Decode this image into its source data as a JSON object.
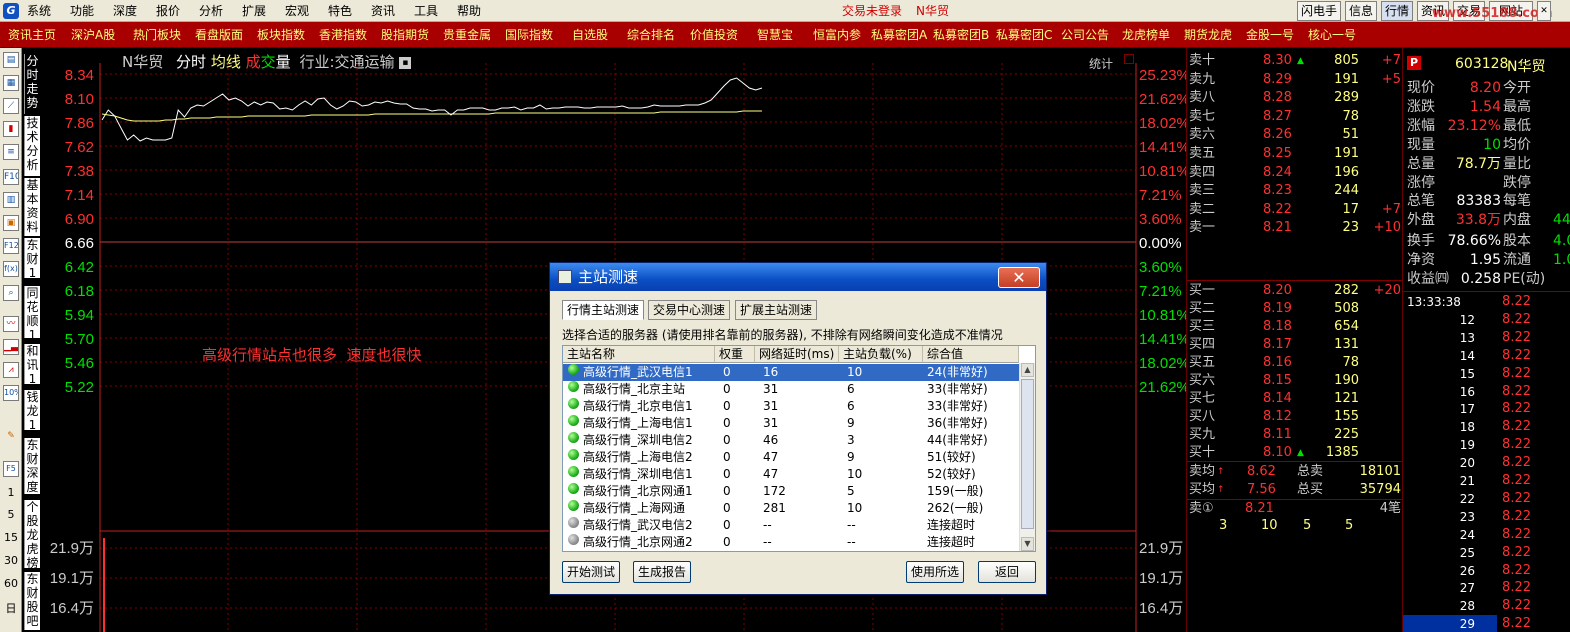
{
  "menubar": {
    "items": [
      "系统",
      "功能",
      "深度",
      "报价",
      "分析",
      "扩展",
      "宏观",
      "特色",
      "资讯",
      "工具",
      "帮助"
    ],
    "status_login": "交易未登录",
    "status_stock": "N华贸",
    "right_buttons": [
      "闪电手",
      "信息",
      "行情",
      "资讯",
      "交易",
      "网站"
    ],
    "watermark": "www.55188.com"
  },
  "tabbar": {
    "tabs": [
      "资讯主页",
      "深沪A股",
      "热门板块",
      "看盘版面",
      "板块指数",
      "香港指数",
      "股指期货",
      "贵重金属",
      "国际指数",
      "自选股",
      "综合排名",
      "价值投资",
      "智慧宝",
      "恒富内参",
      "私募密团A",
      "私募密团B",
      "私募密团C",
      "公司公告",
      "龙虎榜单",
      "期货龙虎",
      "金股一号",
      "核心一号"
    ]
  },
  "left_toolbar": {
    "icons": [
      "book-icon",
      "grid-icon",
      "line-chart-icon",
      "candle-chart-icon",
      "list-icon",
      "f10-icon",
      "table-icon",
      "calculator-icon",
      "f12-icon",
      "fx-icon",
      "magnifier-icon",
      "trend-icon",
      "bar-chart-icon",
      "mountain-chart-icon",
      "percent-icon",
      "pencil-icon",
      "f5-icon"
    ],
    "icon_text": {
      "f10": "F10",
      "f12": "F12",
      "fx": "f(x)",
      "pct": "10%",
      "f5": "F5"
    },
    "numbers": [
      "1",
      "5",
      "15",
      "30",
      "60",
      "日"
    ]
  },
  "vertical_tabs": [
    "分时走势",
    "技术分析",
    "基本资料",
    "东财10",
    "同花顺10",
    "和讯10",
    "钱龙10",
    "东财深度",
    "个股龙虎榜",
    "东财股吧"
  ],
  "chart": {
    "stock_name": "N华贸",
    "mode_labels": [
      "分时",
      "均线",
      "成",
      "交",
      "量"
    ],
    "industry_label": "行业:交通运输",
    "stats_button": "统计",
    "annotation": "高级行情站点也很多  速度也很快",
    "price_ticks": [
      "8.34",
      "8.10",
      "7.86",
      "7.62",
      "7.38",
      "7.14",
      "6.90",
      "6.66",
      "6.42",
      "6.18",
      "5.94",
      "5.70",
      "5.46",
      "5.22"
    ],
    "pct_ticks": [
      "25.23%",
      "21.62%",
      "18.02%",
      "14.41%",
      "10.81%",
      "7.21%",
      "3.60%",
      "0.00%",
      "3.60%",
      "7.21%",
      "10.81%",
      "14.41%",
      "18.02%",
      "21.62%"
    ],
    "volume_ticks": [
      "21.9万",
      "19.1万",
      "16.4万"
    ],
    "colors": {
      "up": "#ff3030",
      "down": "#00e000",
      "flat": "#ffffff",
      "grid": "#800000",
      "price_line": "#ffffff",
      "avg_line": "#ffff80"
    }
  },
  "chart_data": {
    "type": "line",
    "title": "N华贸",
    "xlabel": "",
    "ylabel": "",
    "ylim": [
      5.1,
      8.34
    ],
    "series": [
      {
        "values": [
          7.88,
          7.98,
          7.92,
          7.8,
          7.68,
          7.73,
          7.67,
          7.7,
          7.68,
          7.68,
          7.68,
          7.7,
          7.98,
          7.91,
          8.0,
          8.03,
          8.02,
          8.06,
          8.1,
          8.14,
          8.08,
          8.1,
          8.07,
          8.02,
          8.06,
          8.03,
          8.06,
          8.05,
          7.99,
          8.0,
          7.98,
          8.03,
          8.07,
          8.03,
          8.09,
          8.1,
          8.03,
          7.99,
          8.02,
          8.07,
          8.06,
          8.02,
          8.03,
          8.06,
          8.05,
          8.07,
          8.05,
          8.04,
          8.04,
          8.0,
          7.99,
          7.99,
          7.97,
          7.98,
          7.98,
          7.93,
          7.98,
          7.98,
          8.0,
          8.0,
          8.0,
          7.98,
          7.98,
          8.0,
          8.0,
          8.01,
          7.98,
          8.0,
          8.0,
          8.03,
          7.99,
          8.0,
          8.0,
          8.01,
          8.01,
          8.01,
          8.0,
          8.0,
          8.01,
          8.01,
          8.01,
          8.01,
          8.02,
          8.0,
          8.0,
          8.0,
          8.01,
          8.03,
          8.02,
          8.02,
          8.02,
          8.02,
          8.03,
          8.03,
          8.03,
          8.05,
          8.08,
          8.15,
          8.22,
          8.28,
          8.3,
          8.25,
          8.2,
          8.18,
          8.2
        ]
      },
      {
        "values": [
          7.94,
          7.93,
          7.92,
          7.9,
          7.88,
          7.87,
          7.87,
          7.87,
          7.87,
          7.87,
          7.88,
          7.88,
          7.89,
          7.89,
          7.9,
          7.9,
          7.9,
          7.9,
          7.91,
          7.91,
          7.91,
          7.91,
          7.91,
          7.92,
          7.92,
          7.92,
          7.92,
          7.92,
          7.92,
          7.92,
          7.92,
          7.92,
          7.92,
          7.93,
          7.93,
          7.93,
          7.93,
          7.93,
          7.93,
          7.93,
          7.93,
          7.93,
          7.93,
          7.94,
          7.94,
          7.94,
          7.94,
          7.94,
          7.94,
          7.94,
          7.94,
          7.94,
          7.94,
          7.94,
          7.94,
          7.94,
          7.94,
          7.94,
          7.94,
          7.94,
          7.94,
          7.94,
          7.95,
          7.95,
          7.95,
          7.95,
          7.95,
          7.95,
          7.95,
          7.95,
          7.95,
          7.95,
          7.95,
          7.95,
          7.95,
          7.95,
          7.95,
          7.95,
          7.95,
          7.95,
          7.95,
          7.95,
          7.95,
          7.95,
          7.95,
          7.95,
          7.95,
          7.95,
          7.96,
          7.96,
          7.96,
          7.96,
          7.96,
          7.96,
          7.96,
          7.96,
          7.96,
          7.96,
          7.96,
          7.96,
          7.96,
          7.97,
          7.97,
          7.97,
          7.97
        ]
      }
    ],
    "grid": true,
    "volume_ylim_note_values": [
      16.4,
      19.1,
      21.9
    ]
  },
  "orderbook": {
    "sells": [
      {
        "label": "卖十",
        "price": "8.30",
        "vol": "805",
        "chg": "+7",
        "arrow": true
      },
      {
        "label": "卖九",
        "price": "8.29",
        "vol": "191",
        "chg": "+5",
        "arrow": false
      },
      {
        "label": "卖八",
        "price": "8.28",
        "vol": "289",
        "chg": "",
        "arrow": false
      },
      {
        "label": "卖七",
        "price": "8.27",
        "vol": "78",
        "chg": "",
        "arrow": false
      },
      {
        "label": "卖六",
        "price": "8.26",
        "vol": "51",
        "chg": "",
        "arrow": false
      },
      {
        "label": "卖五",
        "price": "8.25",
        "vol": "191",
        "chg": "",
        "arrow": false
      },
      {
        "label": "卖四",
        "price": "8.24",
        "vol": "196",
        "chg": "",
        "arrow": false
      },
      {
        "label": "卖三",
        "price": "8.23",
        "vol": "244",
        "chg": "",
        "arrow": false
      },
      {
        "label": "卖二",
        "price": "8.22",
        "vol": "17",
        "chg": "+7",
        "arrow": false
      },
      {
        "label": "卖一",
        "price": "8.21",
        "vol": "23",
        "chg": "+10",
        "arrow": false
      }
    ],
    "buys": [
      {
        "label": "买一",
        "price": "8.20",
        "vol": "282",
        "chg": "+20"
      },
      {
        "label": "买二",
        "price": "8.19",
        "vol": "508",
        "chg": ""
      },
      {
        "label": "买三",
        "price": "8.18",
        "vol": "654",
        "chg": ""
      },
      {
        "label": "买四",
        "price": "8.17",
        "vol": "131",
        "chg": ""
      },
      {
        "label": "买五",
        "price": "8.16",
        "vol": "78",
        "chg": ""
      },
      {
        "label": "买六",
        "price": "8.15",
        "vol": "190",
        "chg": ""
      },
      {
        "label": "买七",
        "price": "8.14",
        "vol": "121",
        "chg": ""
      },
      {
        "label": "买八",
        "price": "8.12",
        "vol": "155",
        "chg": ""
      },
      {
        "label": "买九",
        "price": "8.11",
        "vol": "225",
        "chg": ""
      },
      {
        "label": "买十",
        "price": "8.10",
        "vol": "1385",
        "chg": ""
      }
    ],
    "sell_avg_label": "卖均",
    "sell_avg": "8.62",
    "total_sell_label": "总卖",
    "total_sell": "18101",
    "buy_avg_label": "买均",
    "buy_avg": "7.56",
    "total_buy_label": "总买",
    "total_buy": "35794",
    "queue_label": "卖①",
    "queue_price": "8.21",
    "queue_count": "4笔",
    "queue_orders": [
      "3",
      "10",
      "5",
      "5"
    ]
  },
  "info": {
    "badge": "P",
    "code": "603128",
    "name": "N华贸",
    "rows": [
      {
        "l1": "现价",
        "v1": "8.20",
        "c1": "#ff3030",
        "l2": "今开",
        "v2": ""
      },
      {
        "l1": "涨跌",
        "v1": "1.54",
        "c1": "#ff3030",
        "l2": "最高",
        "v2": ""
      },
      {
        "l1": "涨幅",
        "v1": "23.12%",
        "c1": "#ff3030",
        "l2": "最低",
        "v2": ""
      },
      {
        "l1": "现量",
        "v1": "10",
        "c1": "#00e000",
        "l2": "均价",
        "v2": ""
      },
      {
        "l1": "总量",
        "v1": "78.7万",
        "c1": "#ffff80",
        "l2": "量比",
        "v2": ""
      },
      {
        "l1": "涨停",
        "v1": "",
        "c1": "#ff3030",
        "l2": "跌停",
        "v2": ""
      },
      {
        "l1": "总笔",
        "v1": "83383",
        "c1": "#ffffff",
        "l2": "每笔",
        "v2": ""
      },
      {
        "l1": "外盘",
        "v1": "33.8万",
        "c1": "#ff3030",
        "l2": "内盘",
        "v2": "44"
      },
      {
        "l1": "换手",
        "v1": "78.66%",
        "c1": "#ffffff",
        "l2": "股本",
        "v2": "4.0"
      },
      {
        "l1": "净资",
        "v1": "1.95",
        "c1": "#ffffff",
        "l2": "流通",
        "v2": "1.0"
      },
      {
        "l1": "收益㈣",
        "v1": "0.258",
        "c1": "#ffffff",
        "l2": "PE(动)",
        "v2": ""
      }
    ],
    "ticks": [
      {
        "t": "13:33:38",
        "p": "8.22"
      },
      {
        "t": "12",
        "p": "8.22"
      },
      {
        "t": "13",
        "p": "8.22"
      },
      {
        "t": "14",
        "p": "8.22"
      },
      {
        "t": "15",
        "p": "8.22"
      },
      {
        "t": "16",
        "p": "8.22"
      },
      {
        "t": "17",
        "p": "8.22"
      },
      {
        "t": "18",
        "p": "8.22"
      },
      {
        "t": "19",
        "p": "8.22"
      },
      {
        "t": "20",
        "p": "8.22"
      },
      {
        "t": "21",
        "p": "8.22"
      },
      {
        "t": "22",
        "p": "8.22"
      },
      {
        "t": "23",
        "p": "8.22"
      },
      {
        "t": "24",
        "p": "8.22"
      },
      {
        "t": "25",
        "p": "8.22"
      },
      {
        "t": "26",
        "p": "8.22"
      },
      {
        "t": "27",
        "p": "8.22"
      },
      {
        "t": "28",
        "p": "8.22"
      },
      {
        "t": "29",
        "p": "8.22"
      }
    ]
  },
  "dialog": {
    "title": "主站测速",
    "close": "✕",
    "tabs": [
      "行情主站测速",
      "交易中心测速",
      "扩展主站测速"
    ],
    "note": "选择合适的服务器 (请使用排名靠前的服务器), 不排除有网络瞬间变化造成不准情况",
    "columns": [
      "主站名称",
      "权重",
      "网络延时(ms)",
      "主站负载(%)",
      "综合值"
    ],
    "rows": [
      {
        "name": "高级行情_武汉电信1",
        "w": "0",
        "delay": "16",
        "load": "10",
        "score": "24(非常好)",
        "ok": true
      },
      {
        "name": "高级行情_北京主站",
        "w": "0",
        "delay": "31",
        "load": "6",
        "score": "33(非常好)",
        "ok": true
      },
      {
        "name": "高级行情_北京电信1",
        "w": "0",
        "delay": "31",
        "load": "6",
        "score": "33(非常好)",
        "ok": true
      },
      {
        "name": "高级行情_上海电信1",
        "w": "0",
        "delay": "31",
        "load": "9",
        "score": "36(非常好)",
        "ok": true
      },
      {
        "name": "高级行情_深圳电信2",
        "w": "0",
        "delay": "46",
        "load": "3",
        "score": "44(非常好)",
        "ok": true
      },
      {
        "name": "高级行情_上海电信2",
        "w": "0",
        "delay": "47",
        "load": "9",
        "score": "51(较好)",
        "ok": true
      },
      {
        "name": "高级行情_深圳电信1",
        "w": "0",
        "delay": "47",
        "load": "10",
        "score": "52(较好)",
        "ok": true
      },
      {
        "name": "高级行情_北京网通1",
        "w": "0",
        "delay": "172",
        "load": "5",
        "score": "159(一般)",
        "ok": true
      },
      {
        "name": "高级行情_上海网通",
        "w": "0",
        "delay": "281",
        "load": "10",
        "score": "262(一般)",
        "ok": true
      },
      {
        "name": "高级行情_武汉电信2",
        "w": "0",
        "delay": "--",
        "load": "--",
        "score": "连接超时",
        "ok": false
      },
      {
        "name": "高级行情_北京网通2",
        "w": "0",
        "delay": "--",
        "load": "--",
        "score": "连接超时",
        "ok": false
      }
    ],
    "buttons": {
      "start": "开始测试",
      "report": "生成报告",
      "use": "使用所选",
      "back": "返回"
    }
  }
}
